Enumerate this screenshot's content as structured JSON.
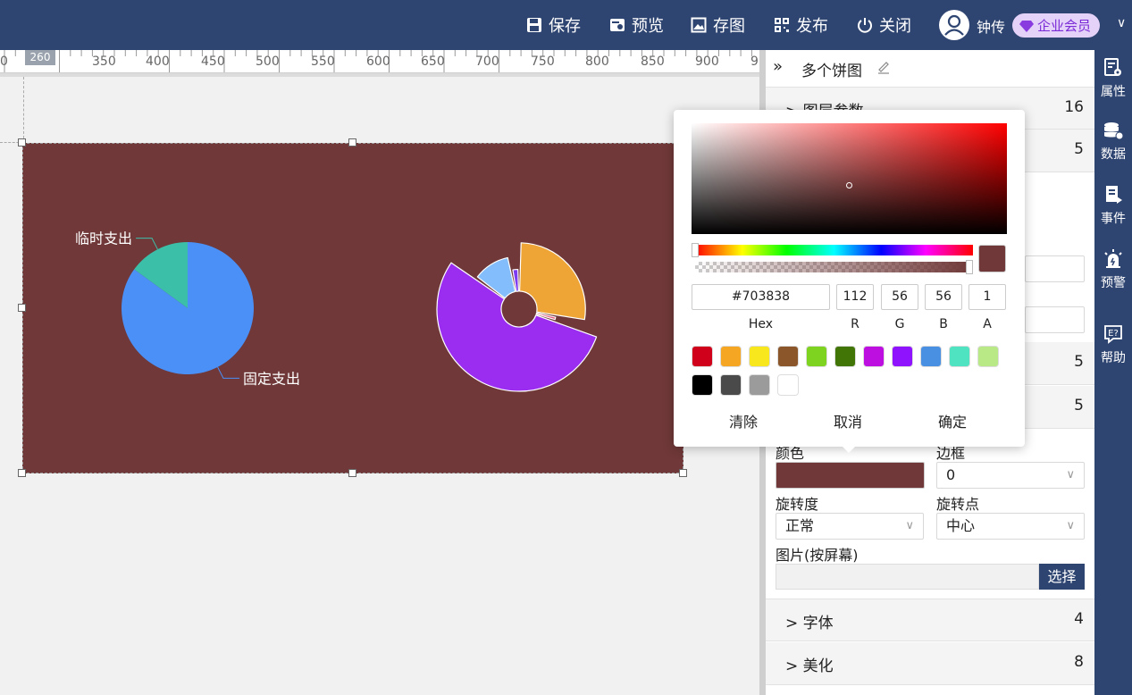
{
  "toolbar": {
    "save": "保存",
    "preview": "预览",
    "save_image": "存图",
    "publish": "发布",
    "close": "关闭",
    "username": "钟传",
    "membership": "企业会员"
  },
  "ruler": {
    "marker": "260",
    "ticks": [
      "0",
      "350",
      "400",
      "450",
      "500",
      "550",
      "600",
      "650",
      "700",
      "750",
      "800",
      "850",
      "900",
      "9"
    ]
  },
  "component_bg": "#703838",
  "chart_data": [
    {
      "type": "pie",
      "labels": [
        "临时支出",
        "固定支出"
      ],
      "values": [
        15,
        85
      ],
      "colors": [
        "#3cbfa9",
        "#4a90f7"
      ]
    },
    {
      "type": "pie",
      "variant": "rose",
      "labels": [],
      "values": [
        28,
        2,
        55,
        12,
        3
      ],
      "colors": [
        "#eea536",
        "#e8547a",
        "#9b2df0",
        "#83bdfb",
        "#7d3bf2"
      ]
    }
  ],
  "panel": {
    "title": "多个饼图",
    "sections": [
      {
        "label": "图层参数",
        "count": "16"
      },
      {
        "count": "5"
      },
      {
        "count": "5"
      },
      {
        "count": "5"
      }
    ],
    "color_label": "颜色",
    "border_label": "边框",
    "border_value": "0",
    "rotation_label": "旋转度",
    "rotation_value": "正常",
    "pivot_label": "旋转点",
    "pivot_value": "中心",
    "image_label": "图片(按屏幕)",
    "image_button": "选择",
    "font_section": {
      "label": "字体",
      "count": "4"
    },
    "beautify_section": {
      "label": "美化",
      "count": "8"
    }
  },
  "sidebar": {
    "items": [
      "属性",
      "数据",
      "事件",
      "预警",
      "帮助"
    ]
  },
  "picker": {
    "hex": "#703838",
    "r": "112",
    "g": "56",
    "b": "56",
    "a": "1",
    "hex_label": "Hex",
    "r_label": "R",
    "g_label": "G",
    "b_label": "B",
    "a_label": "A",
    "swatches": [
      "#d0021b",
      "#f5a623",
      "#f8e71c",
      "#8b572a",
      "#7ed321",
      "#417505",
      "#bd10e0",
      "#9013fe",
      "#4a90e2",
      "#50e3c2",
      "#b8e986",
      "#000000",
      "#4a4a4a",
      "#9b9b9b",
      "#ffffff"
    ],
    "clear": "清除",
    "cancel": "取消",
    "confirm": "确定"
  }
}
